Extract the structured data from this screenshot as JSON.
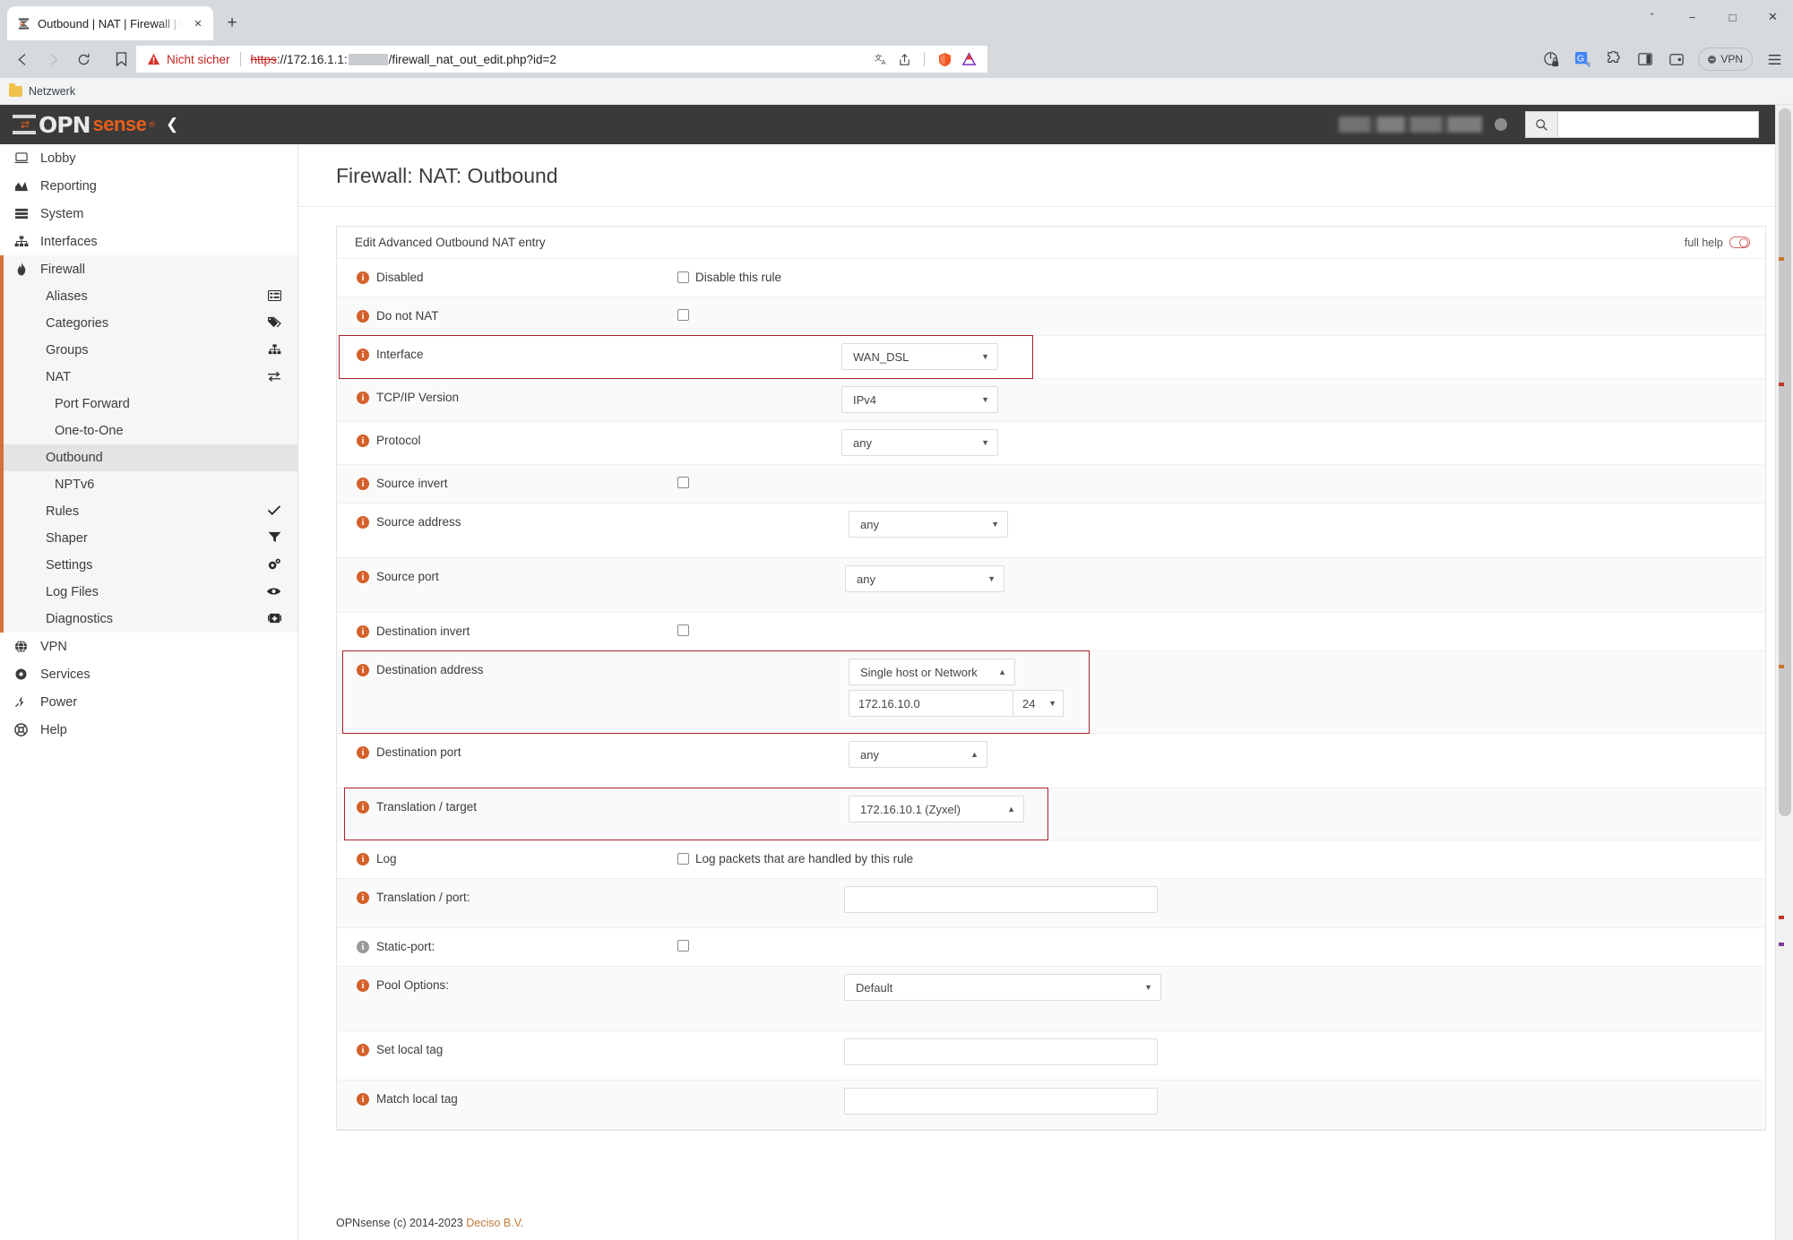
{
  "browser": {
    "tab": {
      "title": "Outbound | NAT | Firewall | OPNs",
      "favicon": "opnsense-favicon",
      "close": "×"
    },
    "newtab_label": "+",
    "window_controls": {
      "minimize": "−",
      "maximize": "□",
      "close": "✕",
      "chevron": "ˇ"
    },
    "nav": {
      "back": "◁",
      "forward": "▷",
      "reload": "⟳"
    },
    "omnibox": {
      "security_label": "Nicht sicher",
      "url_scheme": "https",
      "url_rest": "://172.16.1.1:",
      "url_path": "/firewall_nat_out_edit.php?id=2",
      "translate_icon": "translate-icon",
      "share_icon": "share-icon",
      "brave_icon": "brave-shield-icon",
      "extension_icon": "extension-triangle-icon"
    },
    "toolbar_right": [
      "sync-icon",
      "google-translate-icon",
      "extensions-puzzle-icon",
      "sidebar-panel-icon",
      "wallet-icon"
    ],
    "vpn_label": "VPN",
    "menu_icon": "hamburger-menu-icon",
    "bookmark_bar": {
      "folder_label": "Netzwerk"
    }
  },
  "opnsense": {
    "logo": {
      "opn": "OPN",
      "sense": "sense",
      "reg": "®"
    },
    "collapse_icon": "chevron-left-icon",
    "search_icon": "search-icon",
    "search_placeholder": ""
  },
  "sidebar": {
    "top_items": [
      {
        "label": "Lobby",
        "icon": "laptop-icon"
      },
      {
        "label": "Reporting",
        "icon": "chart-area-icon"
      },
      {
        "label": "System",
        "icon": "server-icon"
      },
      {
        "label": "Interfaces",
        "icon": "sitemap-icon"
      }
    ],
    "group": {
      "label": "Firewall",
      "icon": "fire-icon"
    },
    "group_items": [
      {
        "label": "Aliases",
        "icon": "list-icon"
      },
      {
        "label": "Categories",
        "icon": "tags-icon"
      },
      {
        "label": "Groups",
        "icon": "sitemap-icon"
      },
      {
        "label": "NAT",
        "icon": "exchange-icon"
      },
      {
        "label": "Port Forward",
        "icon": "",
        "sub": true
      },
      {
        "label": "One-to-One",
        "icon": "",
        "sub": true
      },
      {
        "label": "Outbound",
        "icon": "",
        "sub": true,
        "active": true
      },
      {
        "label": "NPTv6",
        "icon": "",
        "sub": true
      },
      {
        "label": "Rules",
        "icon": "check-icon"
      },
      {
        "label": "Shaper",
        "icon": "filter-icon"
      },
      {
        "label": "Settings",
        "icon": "gears-icon"
      },
      {
        "label": "Log Files",
        "icon": "eye-icon"
      },
      {
        "label": "Diagnostics",
        "icon": "medkit-icon"
      }
    ],
    "bottom_items": [
      {
        "label": "VPN",
        "icon": "globe-icon"
      },
      {
        "label": "Services",
        "icon": "gear-icon"
      },
      {
        "label": "Power",
        "icon": "plug-icon"
      },
      {
        "label": "Help",
        "icon": "lifebuoy-icon"
      }
    ]
  },
  "page": {
    "title": "Firewall: NAT: Outbound",
    "panel_title": "Edit Advanced Outbound NAT entry",
    "full_help_label": "full help",
    "footer_text": "OPNsense (c) 2014-2023 ",
    "footer_link": "Deciso B.V."
  },
  "form": {
    "rows": [
      {
        "label": "Disabled",
        "type": "checkbox",
        "checkbox_label": "Disable this rule",
        "checked": false
      },
      {
        "label": "Do not NAT",
        "type": "checkbox",
        "checkbox_label": "",
        "checked": false
      },
      {
        "label": "Interface",
        "type": "select",
        "value": "WAN_DSL",
        "highlight": true
      },
      {
        "label": "TCP/IP Version",
        "type": "select",
        "value": "IPv4"
      },
      {
        "label": "Protocol",
        "type": "select",
        "value": "any"
      },
      {
        "label": "Source invert",
        "type": "checkbox",
        "checkbox_label": "",
        "checked": false
      },
      {
        "label": "Source address",
        "type": "select",
        "value": "any"
      },
      {
        "label": "Source port",
        "type": "select",
        "value": "any"
      },
      {
        "label": "Destination invert",
        "type": "checkbox",
        "checkbox_label": "",
        "checked": false
      },
      {
        "label": "Destination address",
        "type": "select-ip",
        "value": "Single host or Network",
        "ip": "172.16.10.0",
        "mask": "24",
        "highlight": true
      },
      {
        "label": "Destination port",
        "type": "select",
        "value": "any"
      },
      {
        "label": "Translation / target",
        "type": "select",
        "value": "172.16.10.1 (Zyxel)",
        "highlight": true
      },
      {
        "label": "Log",
        "type": "checkbox",
        "checkbox_label": "Log packets that are handled by this rule",
        "checked": false
      },
      {
        "label": "Translation / port:",
        "type": "text",
        "value": ""
      },
      {
        "label": "Static-port:",
        "type": "checkbox",
        "checkbox_label": "",
        "checked": false,
        "grey_info": true
      },
      {
        "label": "Pool Options:",
        "type": "select",
        "value": "Default"
      },
      {
        "label": "Set local tag",
        "type": "text",
        "value": ""
      },
      {
        "label": "Match local tag",
        "type": "text",
        "value": ""
      }
    ]
  }
}
